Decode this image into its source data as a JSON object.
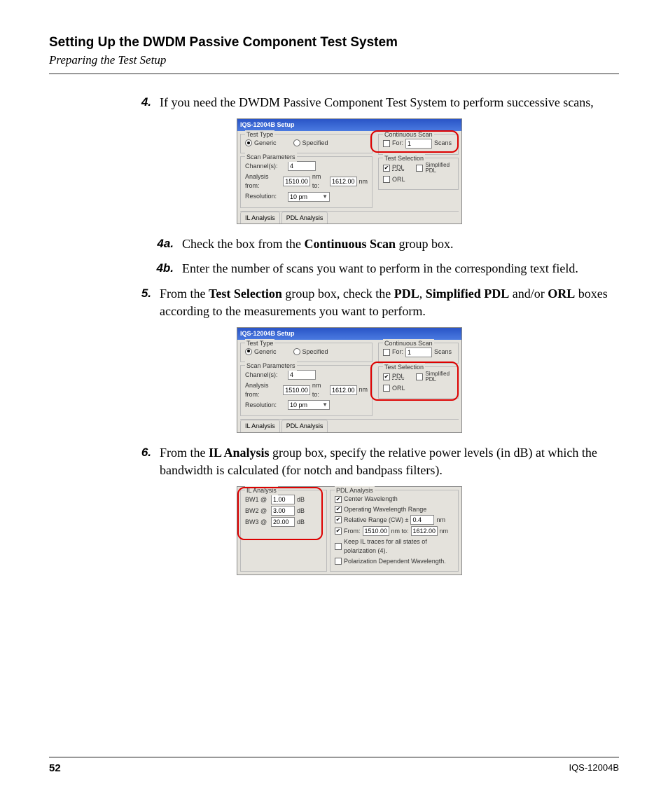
{
  "header": {
    "title": "Setting Up the DWDM Passive Component Test System",
    "subtitle": "Preparing the Test Setup"
  },
  "steps": {
    "s4": {
      "num": "4.",
      "text_a": "If you need the DWDM Passive Component Test System to perform successive scans,"
    },
    "s4a": {
      "num": "4a.",
      "pre": "Check the box from the ",
      "bold": "Continuous Scan",
      "post": " group box."
    },
    "s4b": {
      "num": "4b.",
      "text": "Enter the number of scans you want to perform in the corresponding text field."
    },
    "s5": {
      "num": "5.",
      "t1": "From the ",
      "b1": "Test Selection",
      "t2": " group box, check the ",
      "b2": "PDL",
      "t3": ", ",
      "b3": "Simplified PDL",
      "t4": " and/or ",
      "b4": "ORL",
      "t5": " boxes according to the measurements you want to perform."
    },
    "s6": {
      "num": "6.",
      "t1": "From the ",
      "b1": "IL Analysis",
      "t2": " group box, specify the relative power levels (in dB) at which the bandwidth is calculated (for notch and bandpass filters)."
    }
  },
  "fig1": {
    "title": "IQS-12004B Setup",
    "testType": {
      "label": "Test Type",
      "generic": "Generic",
      "specified": "Specified"
    },
    "contScan": {
      "label": "Continuous Scan",
      "for": "For:",
      "val": "1",
      "scans": "Scans"
    },
    "scanParams": {
      "label": "Scan Parameters",
      "channels_l": "Channel(s):",
      "channels_v": "4",
      "analysis_l": "Analysis from:",
      "from_v": "1510.00",
      "nm_to": "nm to:",
      "to_v": "1612.00",
      "nm": "nm",
      "res_l": "Resolution:",
      "res_v": "10 pm"
    },
    "testSel": {
      "label": "Test Selection",
      "pdl": "PDL",
      "spdl": "Simplified PDL",
      "orl": "ORL"
    },
    "tabs": {
      "il": "IL Analysis",
      "pdl": "PDL Analysis"
    }
  },
  "fig3": {
    "il": {
      "label": "IL Analysis",
      "bw1_l": "BW1 @",
      "bw1_v": "1.00",
      "db": "dB",
      "bw2_l": "BW2 @",
      "bw2_v": "3.00",
      "bw3_l": "BW3 @",
      "bw3_v": "20.00"
    },
    "pdl": {
      "label": "PDL Analysis",
      "cw": "Center Wavelength",
      "owr": "Operating Wavelength Range",
      "rr_l": "Relative Range (CW) ±",
      "rr_v": "0.4",
      "nm": "nm",
      "from_l": "From:",
      "from_v": "1510.00",
      "nm_to": "nm to:",
      "to_v": "1612.00",
      "keep": "Keep IL traces for all states of polarization (4).",
      "pdw": "Polarization Dependent Wavelength."
    }
  },
  "footer": {
    "page": "52",
    "model": "IQS-12004B"
  }
}
